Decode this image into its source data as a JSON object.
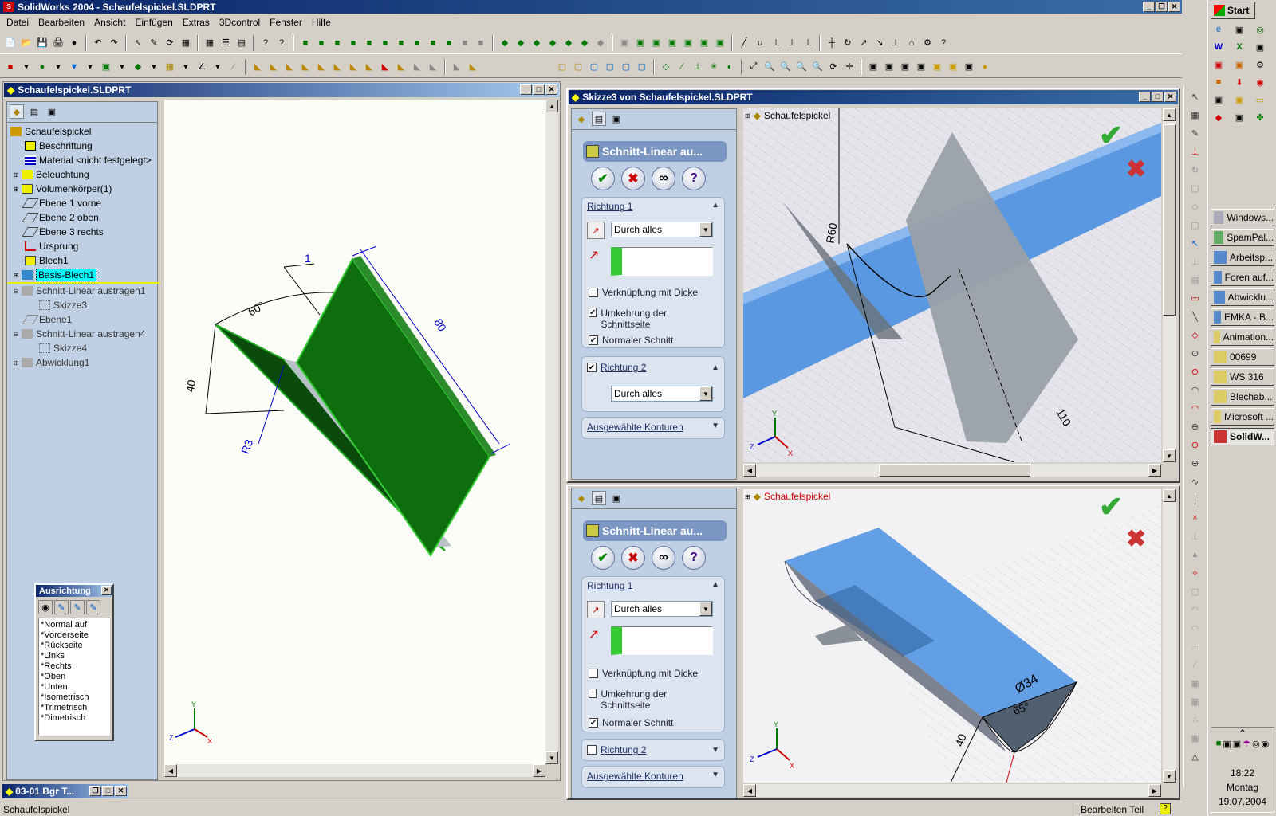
{
  "app": {
    "title": "SolidWorks 2004 - Schaufelspickel.SLDPRT"
  },
  "menu": [
    "Datei",
    "Bearbeiten",
    "Ansicht",
    "Einfügen",
    "Extras",
    "3Dcontrol",
    "Fenster",
    "Hilfe"
  ],
  "docwin": {
    "title": "Schaufelspickel.SLDPRT"
  },
  "tree": {
    "root": "Schaufelspickel",
    "items": [
      "Beschriftung",
      "Material <nicht festgelegt>",
      "Beleuchtung",
      "Volumenkörper(1)",
      "Ebene 1 vorne",
      "Ebene 2 oben",
      "Ebene 3 rechts",
      "Ursprung",
      "Blech1",
      "Basis-Blech1",
      "Schnitt-Linear austragen1",
      "Skizze3",
      "Ebene1",
      "Schnitt-Linear austragen4",
      "Skizze4",
      "Abwicklung1"
    ]
  },
  "orient": {
    "title": "Ausrichtung",
    "items": [
      "*Normal auf",
      "*Vorderseite",
      "*Rückseite",
      "*Links",
      "*Rechts",
      "*Oben",
      "*Unten",
      "*Isometrisch",
      "*Trimetrisch",
      "*Dimetrisch"
    ]
  },
  "dims": {
    "d1": "1",
    "d60": "60°",
    "d80": "80",
    "d40": "40",
    "r3": "R3",
    "r60": "R60",
    "d110": "110",
    "o34": "Ø34",
    "d65": "65°",
    "d40b": "40"
  },
  "win2": {
    "title": "Skizze3 von Schaufelspickel.SLDPRT",
    "treeroot": "Schaufelspickel"
  },
  "win3": {
    "treeroot": "Schaufelspickel"
  },
  "pm": {
    "head": "Schnitt-Linear au...",
    "dir1": "Richtung 1",
    "through": "Durch alles",
    "thick": "Verknüpfung mit Dicke",
    "flip": "Umkehrung der Schnittseite",
    "normal": "Normaler Schnitt",
    "dir2": "Richtung 2",
    "contours": "Ausgewählte Konturen"
  },
  "minwin": {
    "title": "03-01 Bgr T..."
  },
  "status": {
    "left": "Schaufelspickel",
    "right": "Bearbeiten Teil"
  },
  "taskbar": {
    "start": "Start",
    "items": [
      "Windows...",
      "SpamPal...",
      "Arbeitsp...",
      "Foren auf...",
      "Abwicklu...",
      "EMKA - B...",
      "Animation...",
      "00699",
      "WS 316",
      "Blechab...",
      "Microsoft ...",
      "SolidW..."
    ],
    "time": "18:22",
    "day": "Montag",
    "date": "19.07.2004"
  }
}
